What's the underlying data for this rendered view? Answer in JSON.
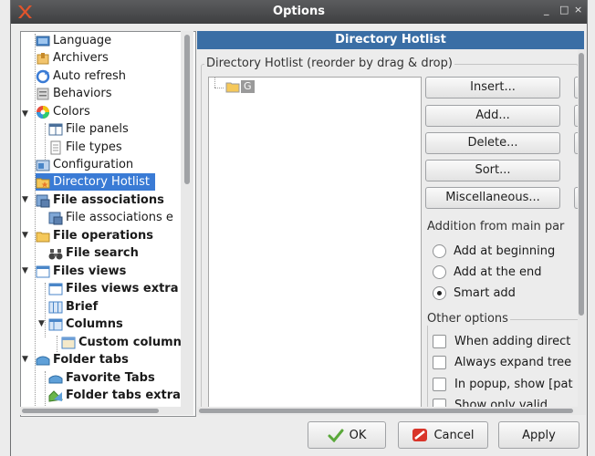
{
  "window": {
    "title": "Options",
    "controls": [
      "_",
      "□",
      "×"
    ]
  },
  "tree": {
    "items": [
      {
        "label": "Language",
        "name": "tree-item-language",
        "icon": "language-icon"
      },
      {
        "label": "Archivers",
        "name": "tree-item-archivers",
        "icon": "archive-icon"
      },
      {
        "label": "Auto refresh",
        "name": "tree-item-auto-refresh",
        "icon": "refresh-icon"
      },
      {
        "label": "Behaviors",
        "name": "tree-item-behaviors",
        "icon": "behaviors-icon"
      },
      {
        "label": "Colors",
        "name": "tree-item-colors",
        "icon": "color-wheel-icon"
      },
      {
        "label": "File panels",
        "name": "tree-item-file-panels",
        "icon": "file-panels-icon"
      },
      {
        "label": "File types",
        "name": "tree-item-file-types",
        "icon": "file-types-icon"
      },
      {
        "label": "Configuration",
        "name": "tree-item-configuration",
        "icon": "configuration-icon"
      },
      {
        "label": "Directory Hotlist",
        "name": "tree-item-directory-hotlist",
        "icon": "folder-star-icon"
      },
      {
        "label": "File associations",
        "name": "tree-item-file-associations",
        "icon": "file-associations-icon"
      },
      {
        "label": "File associations e",
        "name": "tree-item-file-associations-extra",
        "icon": "file-associations-icon"
      },
      {
        "label": "File operations",
        "name": "tree-item-file-operations",
        "icon": "folder-icon"
      },
      {
        "label": "File search",
        "name": "tree-item-file-search",
        "icon": "binoculars-icon"
      },
      {
        "label": "Files views",
        "name": "tree-item-files-views",
        "icon": "files-views-icon"
      },
      {
        "label": "Files views extra",
        "name": "tree-item-files-views-extra",
        "icon": "files-views-icon"
      },
      {
        "label": "Brief",
        "name": "tree-item-brief",
        "icon": "brief-view-icon"
      },
      {
        "label": "Columns",
        "name": "tree-item-columns",
        "icon": "columns-view-icon"
      },
      {
        "label": "Custom column",
        "name": "tree-item-custom-columns",
        "icon": "custom-columns-icon"
      },
      {
        "label": "Folder tabs",
        "name": "tree-item-folder-tabs",
        "icon": "folder-tabs-icon"
      },
      {
        "label": "Favorite Tabs",
        "name": "tree-item-favorite-tabs",
        "icon": "favorite-tabs-icon"
      },
      {
        "label": "Folder tabs extra",
        "name": "tree-item-folder-tabs-extra",
        "icon": "folder-tabs-icon"
      }
    ]
  },
  "panel": {
    "header": "Directory Hotlist",
    "hotlist_group": "Directory Hotlist (reorder by drag & drop)",
    "hotlist_item": "G",
    "buttons": {
      "insert": "Insert...",
      "add": "Add...",
      "delete": "Delete...",
      "sort": "Sort...",
      "misc": "Miscellaneous..."
    },
    "addition_group": "Addition from main par",
    "radios": {
      "beginning": "Add at beginning",
      "end": "Add at the end",
      "smart": "Smart add"
    },
    "other_group": "Other options",
    "checks": {
      "c1": "When adding direct",
      "c2": "Always expand tree",
      "c3": "In popup, show [pat",
      "c4": "Show only valid"
    }
  },
  "footer": {
    "ok": "OK",
    "cancel": "Cancel",
    "apply": "Apply"
  },
  "colors": {
    "selection": "#3a7bd5",
    "header": "#3a6ea5",
    "titlebar": "#4a4b4d"
  }
}
